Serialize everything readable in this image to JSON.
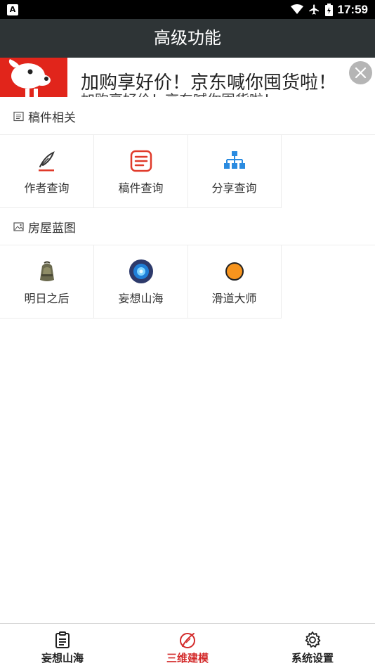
{
  "status_bar": {
    "time": "17:59",
    "icons": [
      "app-notification-icon",
      "wifi-icon",
      "airplane-icon",
      "battery-charging-icon"
    ]
  },
  "header": {
    "title": "高级功能"
  },
  "banner": {
    "text": "加购享好价！京东喊你囤货啦！",
    "icons": [
      "jd-logo",
      "close-icon"
    ]
  },
  "sections": [
    {
      "title": "稿件相关",
      "icon": "document-icon",
      "items": [
        {
          "label": "作者查询",
          "icon": "quill-pen-icon"
        },
        {
          "label": "稿件查询",
          "icon": "note-list-icon"
        },
        {
          "label": "分享查询",
          "icon": "hierarchy-icon"
        }
      ]
    },
    {
      "title": "房屋蓝图",
      "icon": "picture-icon",
      "items": [
        {
          "label": "明日之后",
          "icon": "backpack-icon"
        },
        {
          "label": "妄想山海",
          "icon": "blue-orb-icon"
        },
        {
          "label": "滑道大师",
          "icon": "orange-ball-icon"
        }
      ]
    }
  ],
  "bottom_nav": {
    "active": "三维建模",
    "active_color": "#d32a2a",
    "items": [
      {
        "label": "妄想山海",
        "icon": "clipboard-icon"
      },
      {
        "label": "三维建模",
        "icon": "pen-circle-icon"
      },
      {
        "label": "系统设置",
        "icon": "gear-icon"
      }
    ]
  },
  "colors": {
    "title_bar": "#2e3436",
    "accent": "#d32a2a",
    "jd_red": "#e1251b",
    "icon_blue": "#2a8be0"
  }
}
